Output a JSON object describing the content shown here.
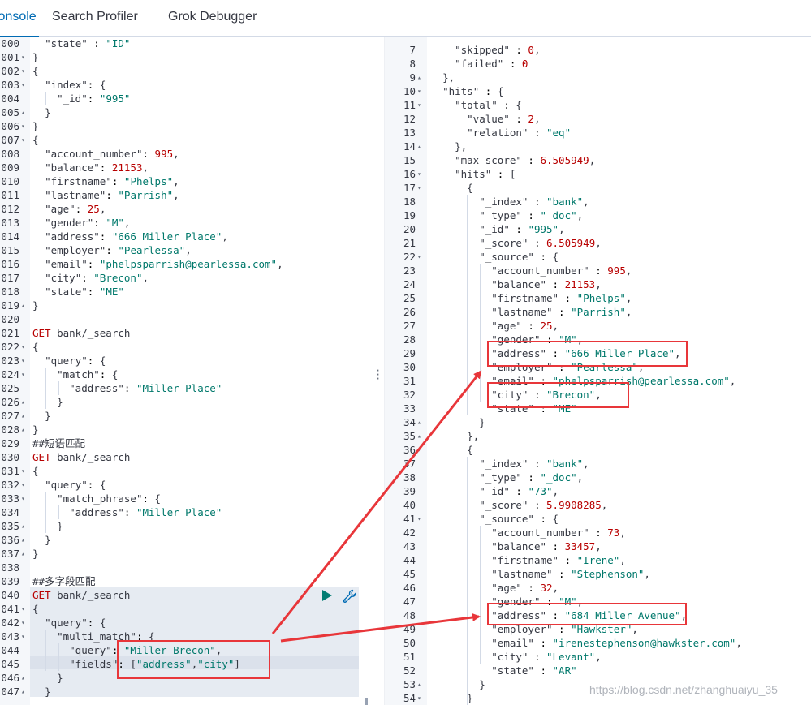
{
  "tabs": [
    {
      "label": "Console",
      "active": true
    },
    {
      "label": "Search Profiler",
      "active": false
    },
    {
      "label": "Grok Debugger",
      "active": false
    }
  ],
  "left_lines": [
    {
      "n": "000",
      "t": "  \"state\" : \"ID\"",
      "fold": ""
    },
    {
      "n": "001",
      "t": "}",
      "fold": "▾"
    },
    {
      "n": "002",
      "t": "{",
      "fold": "▾"
    },
    {
      "n": "003",
      "t": "  \"index\": {",
      "fold": "▾"
    },
    {
      "n": "004",
      "t": "    \"_id\": \"995\"",
      "fold": ""
    },
    {
      "n": "005",
      "t": "  }",
      "fold": "▴"
    },
    {
      "n": "006",
      "t": "}",
      "fold": "▾"
    },
    {
      "n": "007",
      "t": "{",
      "fold": "▾"
    },
    {
      "n": "008",
      "t": "  \"account_number\": 995,",
      "fold": ""
    },
    {
      "n": "009",
      "t": "  \"balance\": 21153,",
      "fold": ""
    },
    {
      "n": "010",
      "t": "  \"firstname\": \"Phelps\",",
      "fold": ""
    },
    {
      "n": "011",
      "t": "  \"lastname\": \"Parrish\",",
      "fold": ""
    },
    {
      "n": "012",
      "t": "  \"age\": 25,",
      "fold": ""
    },
    {
      "n": "013",
      "t": "  \"gender\": \"M\",",
      "fold": ""
    },
    {
      "n": "014",
      "t": "  \"address\": \"666 Miller Place\",",
      "fold": ""
    },
    {
      "n": "015",
      "t": "  \"employer\": \"Pearlessa\",",
      "fold": ""
    },
    {
      "n": "016",
      "t": "  \"email\": \"phelpsparrish@pearlessa.com\",",
      "fold": ""
    },
    {
      "n": "017",
      "t": "  \"city\": \"Brecon\",",
      "fold": ""
    },
    {
      "n": "018",
      "t": "  \"state\": \"ME\"",
      "fold": ""
    },
    {
      "n": "019",
      "t": "}",
      "fold": "▴"
    },
    {
      "n": "020",
      "t": "",
      "fold": ""
    },
    {
      "n": "021",
      "t": "GET bank/_search",
      "fold": ""
    },
    {
      "n": "022",
      "t": "{",
      "fold": "▾"
    },
    {
      "n": "023",
      "t": "  \"query\": {",
      "fold": "▾"
    },
    {
      "n": "024",
      "t": "    \"match\": {",
      "fold": "▾"
    },
    {
      "n": "025",
      "t": "      \"address\": \"Miller Place\"",
      "fold": ""
    },
    {
      "n": "026",
      "t": "    }",
      "fold": "▴"
    },
    {
      "n": "027",
      "t": "  }",
      "fold": "▴"
    },
    {
      "n": "028",
      "t": "}",
      "fold": "▴"
    },
    {
      "n": "029",
      "t": "##短语匹配",
      "fold": ""
    },
    {
      "n": "030",
      "t": "GET bank/_search",
      "fold": ""
    },
    {
      "n": "031",
      "t": "{",
      "fold": "▾"
    },
    {
      "n": "032",
      "t": "  \"query\": {",
      "fold": "▾"
    },
    {
      "n": "033",
      "t": "    \"match_phrase\": {",
      "fold": "▾"
    },
    {
      "n": "034",
      "t": "      \"address\": \"Miller Place\"",
      "fold": ""
    },
    {
      "n": "035",
      "t": "    }",
      "fold": "▴"
    },
    {
      "n": "036",
      "t": "  }",
      "fold": "▴"
    },
    {
      "n": "037",
      "t": "}",
      "fold": "▴"
    },
    {
      "n": "038",
      "t": "",
      "fold": ""
    },
    {
      "n": "039",
      "t": "##多字段匹配",
      "fold": ""
    },
    {
      "n": "040",
      "t": "GET bank/_search",
      "fold": ""
    },
    {
      "n": "041",
      "t": "{",
      "fold": "▾"
    },
    {
      "n": "042",
      "t": "  \"query\": {",
      "fold": "▾"
    },
    {
      "n": "043",
      "t": "    \"multi_match\": {",
      "fold": "▾"
    },
    {
      "n": "044",
      "t": "      \"query\": \"Miller Brecon\",",
      "fold": ""
    },
    {
      "n": "045",
      "t": "      \"fields\": [\"address\",\"city\"]",
      "fold": ""
    },
    {
      "n": "046",
      "t": "    }",
      "fold": "▴"
    },
    {
      "n": "047",
      "t": "  }",
      "fold": "▴"
    }
  ],
  "right_lines": [
    {
      "n": "7",
      "t": "    \"skipped\" : 0,",
      "fold": ""
    },
    {
      "n": "8",
      "t": "    \"failed\" : 0",
      "fold": ""
    },
    {
      "n": "9",
      "t": "  },",
      "fold": "▴"
    },
    {
      "n": "10",
      "t": "  \"hits\" : {",
      "fold": "▾"
    },
    {
      "n": "11",
      "t": "    \"total\" : {",
      "fold": "▾"
    },
    {
      "n": "12",
      "t": "      \"value\" : 2,",
      "fold": ""
    },
    {
      "n": "13",
      "t": "      \"relation\" : \"eq\"",
      "fold": ""
    },
    {
      "n": "14",
      "t": "    },",
      "fold": "▴"
    },
    {
      "n": "15",
      "t": "    \"max_score\" : 6.505949,",
      "fold": ""
    },
    {
      "n": "16",
      "t": "    \"hits\" : [",
      "fold": "▾"
    },
    {
      "n": "17",
      "t": "      {",
      "fold": "▾"
    },
    {
      "n": "18",
      "t": "        \"_index\" : \"bank\",",
      "fold": ""
    },
    {
      "n": "19",
      "t": "        \"_type\" : \"_doc\",",
      "fold": ""
    },
    {
      "n": "20",
      "t": "        \"_id\" : \"995\",",
      "fold": ""
    },
    {
      "n": "21",
      "t": "        \"_score\" : 6.505949,",
      "fold": ""
    },
    {
      "n": "22",
      "t": "        \"_source\" : {",
      "fold": "▾"
    },
    {
      "n": "23",
      "t": "          \"account_number\" : 995,",
      "fold": ""
    },
    {
      "n": "24",
      "t": "          \"balance\" : 21153,",
      "fold": ""
    },
    {
      "n": "25",
      "t": "          \"firstname\" : \"Phelps\",",
      "fold": ""
    },
    {
      "n": "26",
      "t": "          \"lastname\" : \"Parrish\",",
      "fold": ""
    },
    {
      "n": "27",
      "t": "          \"age\" : 25,",
      "fold": ""
    },
    {
      "n": "28",
      "t": "          \"gender\" : \"M\",",
      "fold": ""
    },
    {
      "n": "29",
      "t": "          \"address\" : \"666 Miller Place\",",
      "fold": ""
    },
    {
      "n": "30",
      "t": "          \"employer\" : \"Pearlessa\",",
      "fold": ""
    },
    {
      "n": "31",
      "t": "          \"email\" : \"phelpsparrish@pearlessa.com\",",
      "fold": ""
    },
    {
      "n": "32",
      "t": "          \"city\" : \"Brecon\",",
      "fold": ""
    },
    {
      "n": "33",
      "t": "          \"state\" : \"ME\"",
      "fold": ""
    },
    {
      "n": "34",
      "t": "        }",
      "fold": "▴"
    },
    {
      "n": "35",
      "t": "      },",
      "fold": "▴"
    },
    {
      "n": "36",
      "t": "      {",
      "fold": "▾"
    },
    {
      "n": "37",
      "t": "        \"_index\" : \"bank\",",
      "fold": ""
    },
    {
      "n": "38",
      "t": "        \"_type\" : \"_doc\",",
      "fold": ""
    },
    {
      "n": "39",
      "t": "        \"_id\" : \"73\",",
      "fold": ""
    },
    {
      "n": "40",
      "t": "        \"_score\" : 5.9908285,",
      "fold": ""
    },
    {
      "n": "41",
      "t": "        \"_source\" : {",
      "fold": "▾"
    },
    {
      "n": "42",
      "t": "          \"account_number\" : 73,",
      "fold": ""
    },
    {
      "n": "43",
      "t": "          \"balance\" : 33457,",
      "fold": ""
    },
    {
      "n": "44",
      "t": "          \"firstname\" : \"Irene\",",
      "fold": ""
    },
    {
      "n": "45",
      "t": "          \"lastname\" : \"Stephenson\",",
      "fold": ""
    },
    {
      "n": "46",
      "t": "          \"age\" : 32,",
      "fold": ""
    },
    {
      "n": "47",
      "t": "          \"gender\" : \"M\",",
      "fold": ""
    },
    {
      "n": "48",
      "t": "          \"address\" : \"684 Miller Avenue\",",
      "fold": ""
    },
    {
      "n": "49",
      "t": "          \"employer\" : \"Hawkster\",",
      "fold": ""
    },
    {
      "n": "50",
      "t": "          \"email\" : \"irenestephenson@hawkster.com\",",
      "fold": ""
    },
    {
      "n": "51",
      "t": "          \"city\" : \"Levant\",",
      "fold": ""
    },
    {
      "n": "52",
      "t": "          \"state\" : \"AR\"",
      "fold": ""
    },
    {
      "n": "53",
      "t": "        }",
      "fold": "▴"
    },
    {
      "n": "54",
      "t": "      }",
      "fold": "▾"
    }
  ],
  "watermark": "https://blog.csdn.net/zhanghuaiyu_35",
  "colors": {
    "accent": "#006bb4",
    "annotation": "#e8363a",
    "play": "#017d73"
  }
}
